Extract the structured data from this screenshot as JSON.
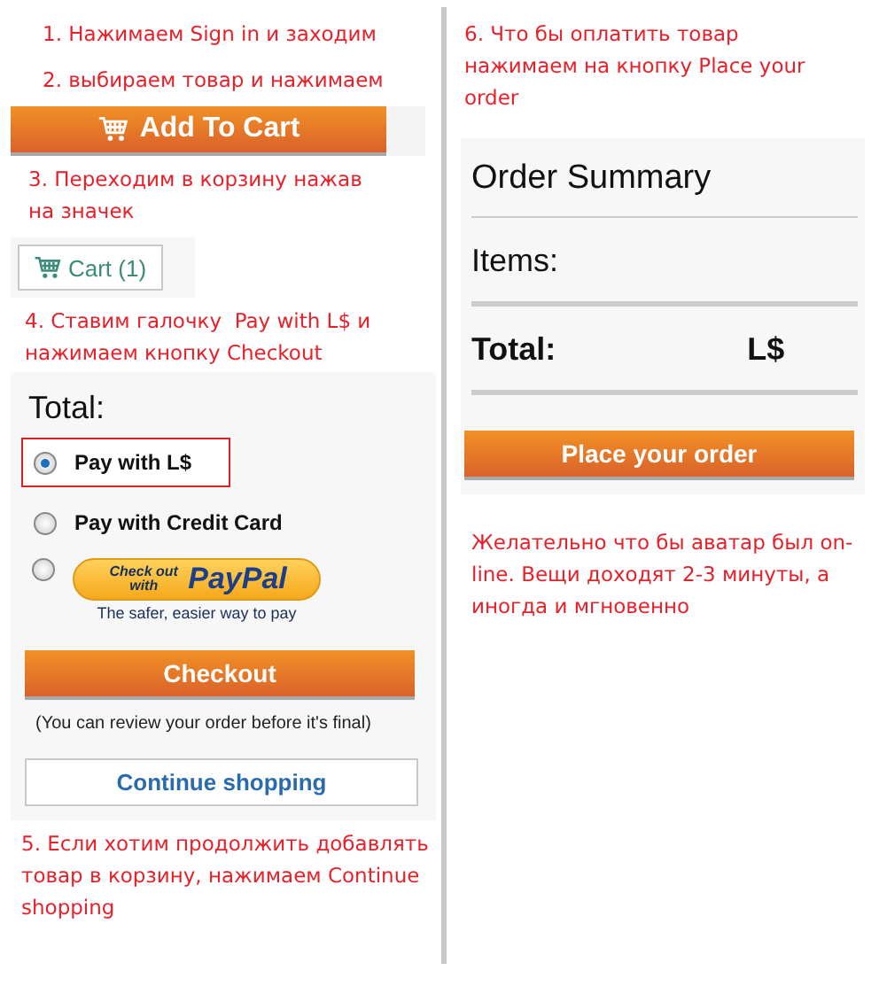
{
  "left": {
    "step_1": "1. Нажимаем Sign in и заходим",
    "step_2": "2. выбираем товар и нажимаем",
    "add_to_cart_button": "Add To Cart",
    "step_3": "3. Переходим в корзину нажав на значек",
    "cart_button": "Cart (1)",
    "step_4": "4. Ставим галочку  Pay with L$ и нажимаем кнопку Checkout",
    "payment": {
      "total_label": "Total:",
      "options": [
        {
          "kind": "text",
          "label": "Pay with L$",
          "selected": true
        },
        {
          "kind": "text",
          "label": "Pay with Credit Card",
          "selected": false
        },
        {
          "kind": "paypal",
          "button_text": "Check out with",
          "brand": "PayPal",
          "tagline": "The safer, easier way to pay",
          "selected": false
        }
      ],
      "checkout_button": "Checkout",
      "note": "(You can review your order before it's final)",
      "continue_button": "Continue shopping"
    },
    "step_5": "5. Если хотим продолжить добавлять товар в корзину, нажимаем Continue shopping"
  },
  "right": {
    "step_6": "6. Что бы оплатить товар нажимаем на кнопку Place your order",
    "order_summary": {
      "title": "Order Summary",
      "items_label": "Items:",
      "total_label": "Total:",
      "total_value": "L$",
      "place_order_button": "Place your order"
    },
    "note": "Желательно что бы аватар был on-line. Вещи доходят 2-3 минуты, а иногда и мгновенно"
  }
}
